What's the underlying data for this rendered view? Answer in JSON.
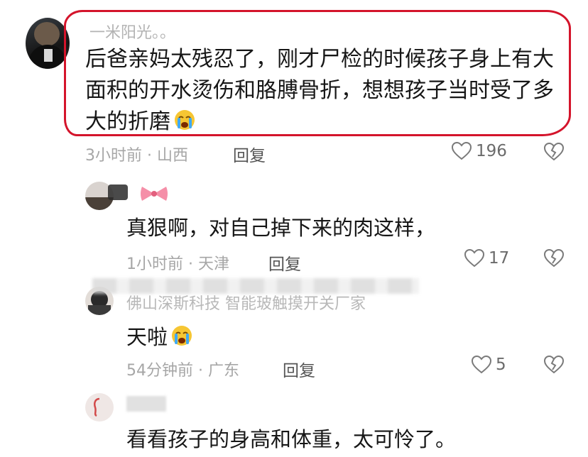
{
  "comments": [
    {
      "username": "一米阳光。。",
      "lines": [
        "后爸亲妈太残忍了，刚才尸检的时候孩子身上有大",
        "面积的开水烫伤和胳膊骨折，想想孩子当时受了多",
        "大的折磨"
      ],
      "meta": "3小时前 · 山西",
      "reply_label": "回复",
      "likes": "196",
      "emoji": "loudly-crying-face"
    },
    {
      "username": "",
      "text": "真狠啊，对自己掉下来的肉这样，",
      "meta": "1小时前 · 天津",
      "reply_label": "回复",
      "likes": "17"
    },
    {
      "username": "佛山深斯科技  智能玻触摸开关厂家",
      "text": "天啦",
      "meta": "54分钟前 · 广东",
      "reply_label": "回复",
      "likes": "5",
      "emoji": "loudly-crying-face"
    },
    {
      "username": "",
      "text": "看看孩子的身高和体重，太可怜了。"
    }
  ],
  "colors": {
    "highlight": "#d4142b",
    "emoji_face": "#f6c633",
    "emoji_tears": "#3fa9f5"
  },
  "icons": [
    "heart-icon",
    "broken-heart-icon",
    "crying-emoji-icon",
    "bow-icon"
  ]
}
